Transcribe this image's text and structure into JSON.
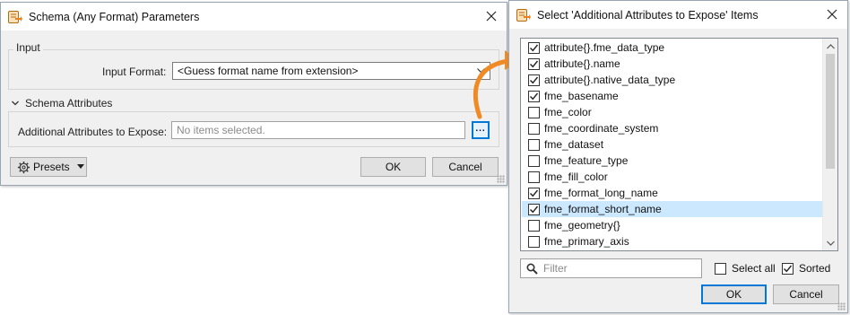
{
  "left_dialog": {
    "title": "Schema (Any Format) Parameters",
    "input_group": {
      "title": "Input",
      "input_format_label": "Input Format:",
      "input_format_value": "<Guess format name from extension>"
    },
    "schema_group": {
      "title": "Schema Attributes",
      "additional_label": "Additional Attributes to Expose:",
      "additional_placeholder": "No items selected.",
      "browse_button": "..."
    },
    "presets_label": "Presets",
    "ok_label": "OK",
    "cancel_label": "Cancel"
  },
  "right_dialog": {
    "title": "Select 'Additional Attributes to Expose' Items",
    "items": [
      {
        "label": "attribute{}.fme_data_type",
        "checked": true,
        "selected": false
      },
      {
        "label": "attribute{}.name",
        "checked": true,
        "selected": false
      },
      {
        "label": "attribute{}.native_data_type",
        "checked": true,
        "selected": false
      },
      {
        "label": "fme_basename",
        "checked": true,
        "selected": false
      },
      {
        "label": "fme_color",
        "checked": false,
        "selected": false
      },
      {
        "label": "fme_coordinate_system",
        "checked": false,
        "selected": false
      },
      {
        "label": "fme_dataset",
        "checked": false,
        "selected": false
      },
      {
        "label": "fme_feature_type",
        "checked": false,
        "selected": false
      },
      {
        "label": "fme_fill_color",
        "checked": false,
        "selected": false
      },
      {
        "label": "fme_format_long_name",
        "checked": true,
        "selected": false
      },
      {
        "label": "fme_format_short_name",
        "checked": true,
        "selected": true
      },
      {
        "label": "fme_geometry{}",
        "checked": false,
        "selected": false
      },
      {
        "label": "fme_primary_axis",
        "checked": false,
        "selected": false
      }
    ],
    "filter_placeholder": "Filter",
    "select_all_label": "Select all",
    "select_all_checked": false,
    "sorted_label": "Sorted",
    "sorted_checked": true,
    "ok_label": "OK",
    "cancel_label": "Cancel"
  },
  "colors": {
    "accent_arrow": "#f08a24",
    "selection": "#cce8ff",
    "focus_border": "#0078d7"
  },
  "icons": {
    "app": "fme-reader-icon",
    "close": "close-icon",
    "presets": "gear-icon"
  }
}
